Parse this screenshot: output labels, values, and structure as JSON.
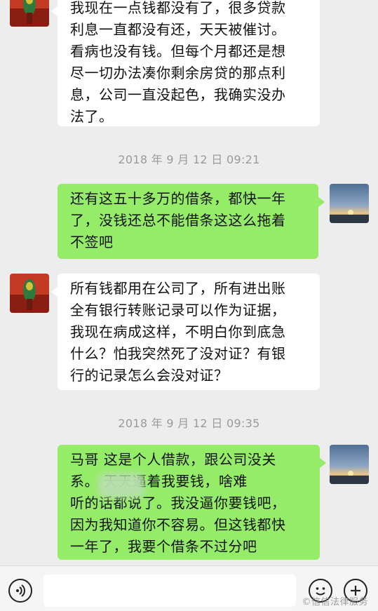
{
  "messages": [
    {
      "side": "left",
      "text": "我现在一点钱都没有了，很多贷款\n利息一直都没有还，天天被催讨。\n看病也没有钱。但每个月都还是想\n尽一切办法凑你剩余房贷的那点利\n息，公司一直没起色，我确实没办\n法了。"
    },
    {
      "side": "right",
      "text": "还有这五十多万的借条，都快一年\n了，没钱还总不能借条这这么拖着\n不签吧"
    },
    {
      "side": "left",
      "text": "所有钱都用在公司了，所有进出账\n全有银行转账记录可以作为证据，\n我现在病成这样，不明白你到底急\n什么？怕我突然死了没对证？有银\n行的记录怎么会没对证？"
    },
    {
      "side": "right",
      "text": "马哥    这是个人借款，跟公司没关\n系。         天天逼着我要钱，啥难\n听的话都说了。我没逼你要钱吧，\n因为我知道你不容易。但这钱都快\n一年了，我要个借条不过分吧"
    }
  ],
  "timestamps": [
    "2018 年 9 月 12 日  09:21",
    "2018 年 9 月 12 日  09:35"
  ],
  "input_bar": {
    "voice_icon": "voice-icon",
    "emoji_icon": "emoji-icon",
    "add_icon": "add-icon",
    "placeholder": ""
  },
  "watermark": "©信信法律服务",
  "colors": {
    "background": "#ededed",
    "bubble_left": "#ffffff",
    "bubble_right": "#95ec69",
    "timestamp": "#9a9a9a"
  }
}
